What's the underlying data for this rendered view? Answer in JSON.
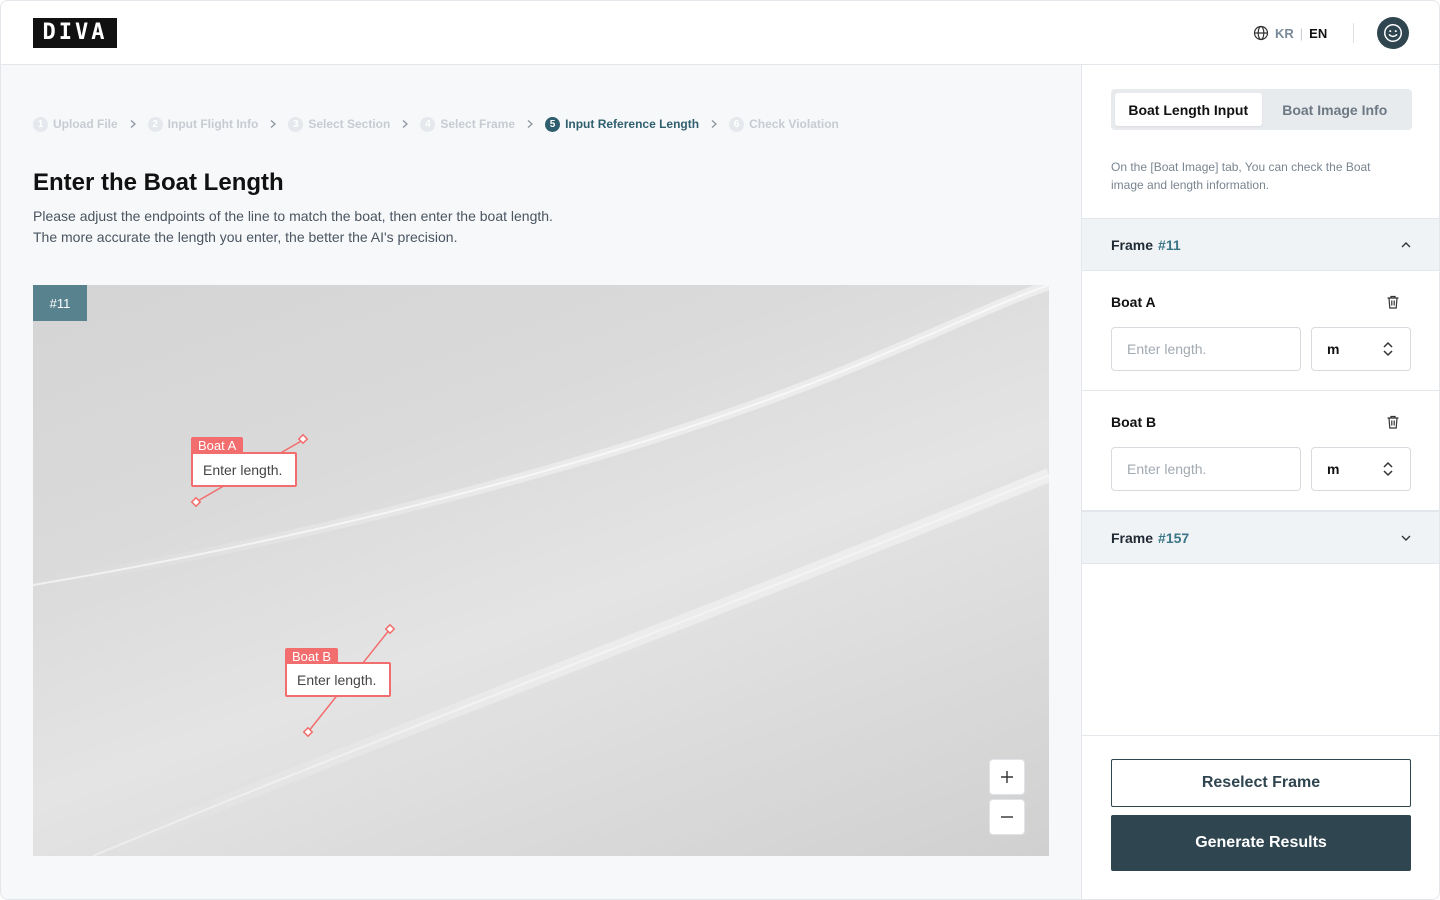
{
  "header": {
    "logo_text": "DIVA",
    "lang_kr": "KR",
    "lang_sep": "|",
    "lang_en": "EN"
  },
  "stepper": {
    "steps": [
      {
        "num": "1",
        "label": "Upload File"
      },
      {
        "num": "2",
        "label": "Input Flight Info"
      },
      {
        "num": "3",
        "label": "Select Section"
      },
      {
        "num": "4",
        "label": "Select Frame"
      },
      {
        "num": "5",
        "label": "Input Reference Length"
      },
      {
        "num": "6",
        "label": "Check Violation"
      }
    ],
    "active_index": 4
  },
  "main": {
    "title": "Enter the Boat Length",
    "desc_line1": "Please adjust the endpoints of the line to match the boat, then enter the boat length.",
    "desc_line2": "The more accurate the length you enter, the better the AI's precision."
  },
  "canvas": {
    "frame_badge": "#11",
    "boats": [
      {
        "tag": "Boat A",
        "placeholder": "Enter length."
      },
      {
        "tag": "Boat B",
        "placeholder": "Enter length."
      }
    ],
    "zoom_in": "+",
    "zoom_out": "−"
  },
  "sidebar": {
    "tabs": [
      "Boat Length Input",
      "Boat Image Info"
    ],
    "active_tab": 0,
    "note": "On the [Boat Image] tab, You can check the Boat image and length information.",
    "frames": [
      {
        "label": "Frame",
        "number": "#11",
        "expanded": true,
        "boats": [
          {
            "name": "Boat A",
            "placeholder": "Enter length.",
            "unit": "m"
          },
          {
            "name": "Boat B",
            "placeholder": "Enter length.",
            "unit": "m"
          }
        ]
      },
      {
        "label": "Frame",
        "number": "#157",
        "expanded": false
      }
    ],
    "reselect_label": "Reselect Frame",
    "generate_label": "Generate Results"
  },
  "colors": {
    "primary": "#2f454f",
    "accent": "#2f5f6e",
    "boat_marker": "#f26d6d",
    "frame_badge": "#58828e"
  },
  "icons": [
    "globe-icon",
    "smiley-avatar-icon",
    "chevron-right-icon",
    "plus-icon",
    "minus-icon",
    "trash-icon",
    "chevron-up-icon",
    "chevron-down-icon",
    "updown-icon"
  ]
}
